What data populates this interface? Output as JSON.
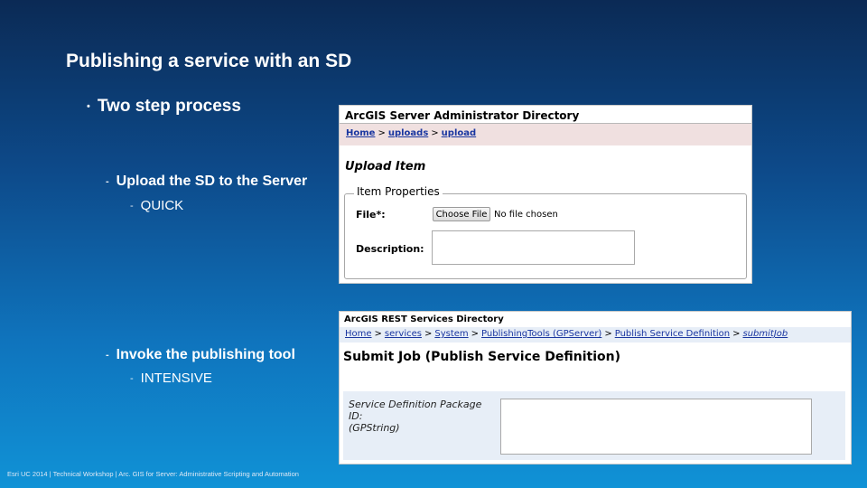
{
  "slide": {
    "title": "Publishing a service with an SD",
    "bullets": {
      "main": "Two step process",
      "step1": "Upload the SD to the Server",
      "step1_note": "QUICK",
      "step2": "Invoke the publishing tool",
      "step2_note": "INTENSIVE"
    },
    "footer": "Esri UC 2014 | Technical Workshop | Arc. GIS for Server: Administrative Scripting and Automation"
  },
  "upload_screen": {
    "header": "ArcGIS Server Administrator Directory",
    "breadcrumb": [
      "Home",
      "uploads",
      "upload"
    ],
    "heading": "Upload Item",
    "legend": "Item Properties",
    "file_label": "File*:",
    "file_button": "Choose File",
    "file_status": "No file chosen",
    "description_label": "Description:"
  },
  "submit_screen": {
    "header": "ArcGIS REST Services Directory",
    "breadcrumb": [
      "Home",
      "services",
      "System",
      "PublishingTools (GPServer)",
      "Publish Service Definition",
      "submitJob"
    ],
    "heading": "Submit Job (Publish Service Definition)",
    "param_label": "Service Definition Package ID:",
    "param_type": "(GPString)"
  },
  "colors": {
    "background_top": "#0b2a55",
    "background_bottom": "#1092d6",
    "link": "#1a36a0",
    "crumb_bg_upload": "#f0e0e0",
    "crumb_bg_rest": "#e7eef7"
  }
}
